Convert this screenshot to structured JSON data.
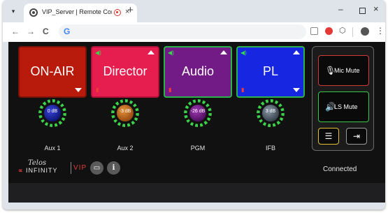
{
  "browser": {
    "tab_title": "VIP_Server | Remote Contro",
    "tab_close": "×",
    "new_tab": "+",
    "window_controls": {
      "minimize": "–",
      "close": "×"
    },
    "nav": {
      "back": "←",
      "forward": "→",
      "reload": "C"
    },
    "omnibox_logo": "G",
    "menu": "⋮"
  },
  "channels": [
    {
      "label": "ON-AIR",
      "color": "#b81a0c"
    },
    {
      "label": "Director",
      "color": "#e61d4f"
    },
    {
      "label": "Audio",
      "color": "#721a85"
    },
    {
      "label": "PL",
      "color": "#1726e0"
    }
  ],
  "knobs": [
    {
      "value": "0 dB",
      "label": "Aux 1"
    },
    {
      "value": "-3 dB",
      "label": "Aux 2"
    },
    {
      "value": "-26 dB",
      "label": "PGM"
    },
    {
      "value": "3 dB",
      "label": "IFB"
    }
  ],
  "side": {
    "mic_mute": "Mic Mute",
    "ls_mute": "LS Mute",
    "icons": {
      "mic": "microphone-icon",
      "speaker": "speaker-icon",
      "settings": "sliders-icon",
      "logout": "logout-icon"
    }
  },
  "footer": {
    "brand_script": "Telos",
    "brand_name": "INFINITY",
    "brand_symbol": "∝",
    "product": "VIP",
    "info": "i",
    "status": "Connected"
  },
  "colors": {
    "accent_green": "#3bd14a",
    "mute_red": "#d23a3a",
    "settings_yellow": "#e2c233"
  }
}
